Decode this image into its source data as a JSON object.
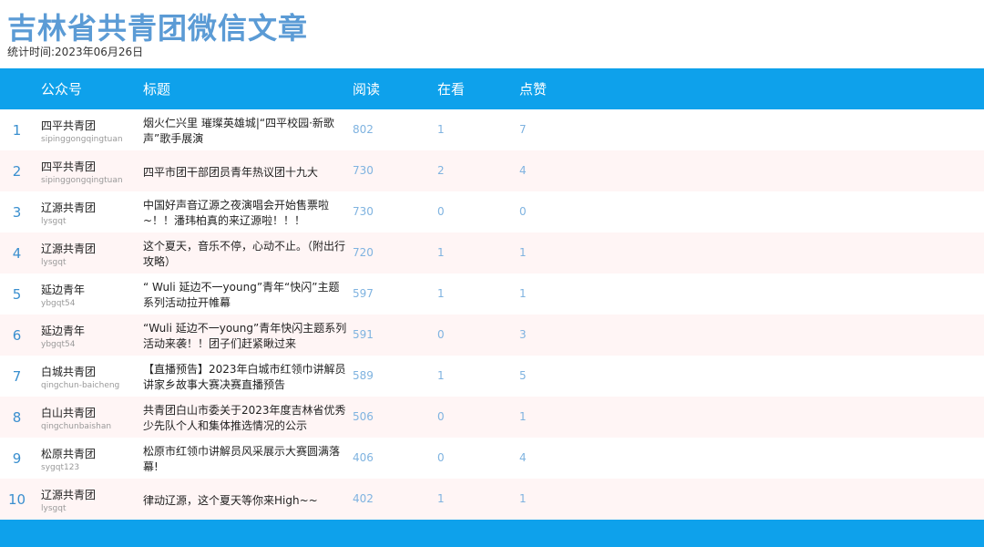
{
  "page": {
    "title": "吉林省共青团微信文章",
    "subtitle": "统计时间:2023年06月26日"
  },
  "table": {
    "headers": {
      "account": "公众号",
      "title": "标题",
      "read": "阅读",
      "look": "在看",
      "like": "点赞"
    },
    "rows": [
      {
        "rank": "1",
        "account": "四平共青团",
        "account_id": "sipinggongqingtuan",
        "title": "烟火仁兴里 璀璨英雄城|“四平校园·新歌声”歌手展演",
        "read": "802",
        "look": "1",
        "like": "7"
      },
      {
        "rank": "2",
        "account": "四平共青团",
        "account_id": "sipinggongqingtuan",
        "title": "四平市团干部团员青年热议团十九大",
        "read": "730",
        "look": "2",
        "like": "4"
      },
      {
        "rank": "3",
        "account": "辽源共青团",
        "account_id": "lysgqt",
        "title": "中国好声音辽源之夜演唱会开始售票啦~！！潘玮柏真的来辽源啦！！！",
        "read": "730",
        "look": "0",
        "like": "0"
      },
      {
        "rank": "4",
        "account": "辽源共青团",
        "account_id": "lysgqt",
        "title": "这个夏天，音乐不停，心动不止。（附出行攻略）",
        "read": "720",
        "look": "1",
        "like": "1"
      },
      {
        "rank": "5",
        "account": "延边青年",
        "account_id": "ybgqt54",
        "title": "“ Wuli 延边不一young”青年“快闪”主题系列活动拉开帷幕",
        "read": "597",
        "look": "1",
        "like": "1"
      },
      {
        "rank": "6",
        "account": "延边青年",
        "account_id": "ybgqt54",
        "title": "“Wuli 延边不一young”青年快闪主题系列活动来袭！！团子们赶紧瞅过来",
        "read": "591",
        "look": "0",
        "like": "3"
      },
      {
        "rank": "7",
        "account": "白城共青团",
        "account_id": "qingchun-baicheng",
        "title": "【直播预告】2023年白城市红领巾讲解员讲家乡故事大赛决赛直播预告",
        "read": "589",
        "look": "1",
        "like": "5"
      },
      {
        "rank": "8",
        "account": "白山共青团",
        "account_id": "qingchunbaishan",
        "title": "共青团白山市委关于2023年度吉林省优秀少先队个人和集体推选情况的公示",
        "read": "506",
        "look": "0",
        "like": "1"
      },
      {
        "rank": "9",
        "account": "松原共青团",
        "account_id": "sygqt123",
        "title": "松原市红领巾讲解员风采展示大赛圆满落幕!",
        "read": "406",
        "look": "0",
        "like": "4"
      },
      {
        "rank": "10",
        "account": "辽源共青团",
        "account_id": "lysgqt",
        "title": "律动辽源，这个夏天等你来High~~",
        "read": "402",
        "look": "1",
        "like": "1"
      }
    ]
  },
  "colors": {
    "accent": "#0ea1eb",
    "title": "#5b9bd5",
    "row_alt": "#fff5f5"
  }
}
